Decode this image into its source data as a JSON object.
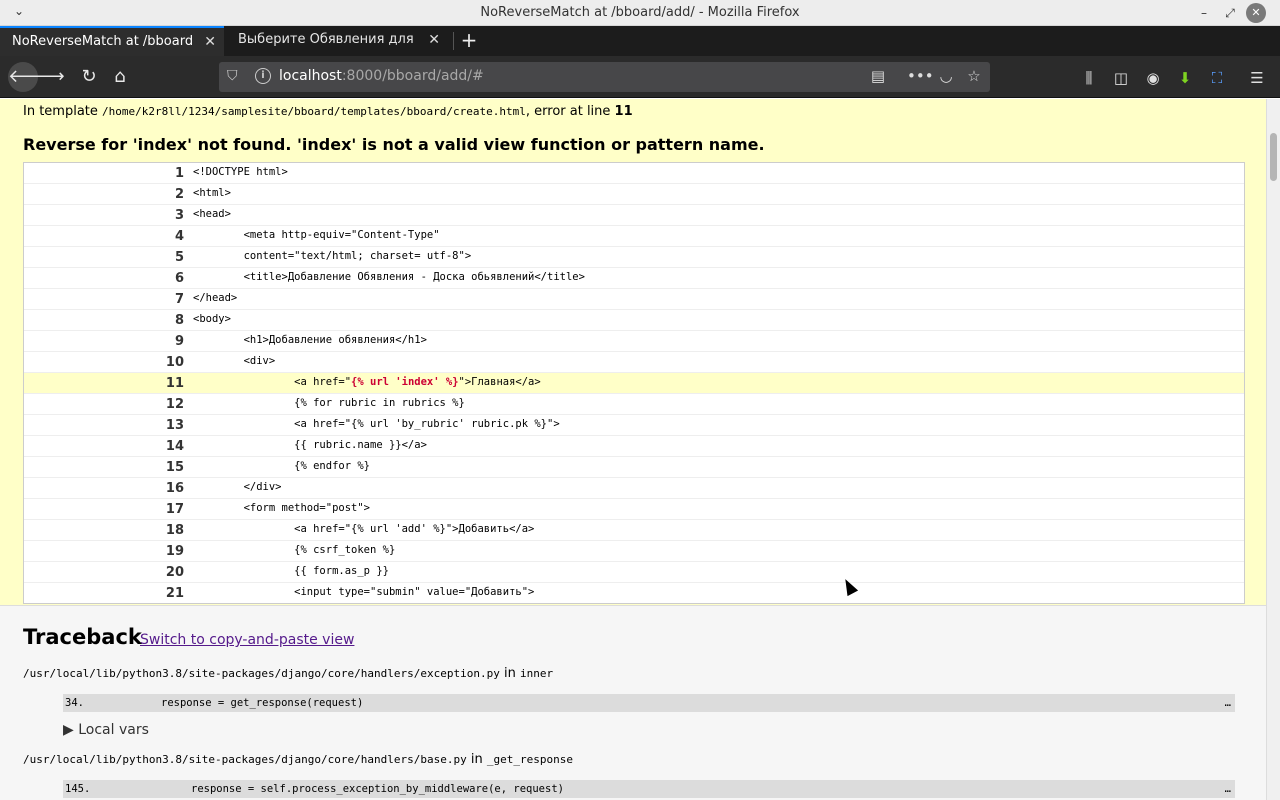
{
  "window": {
    "title": "NoReverseMatch at /bboard/add/ - Mozilla Firefox"
  },
  "tabs": [
    {
      "label": "NoReverseMatch at /bboard/"
    },
    {
      "label": "Выберите Обявления для из"
    }
  ],
  "navbar": {
    "url_host": "localhost",
    "url_rest": ":8000/bboard/add/#"
  },
  "error": {
    "template_prefix": "In template ",
    "template_path": "/home/k2r8ll/1234/samplesite/bboard/templates/bboard/create.html",
    "template_suffix": ", error at line ",
    "error_line": "11",
    "message": "Reverse for 'index' not found. 'index' is not a valid view function or pattern name."
  },
  "source_lines": [
    {
      "num": "1",
      "code": "<!DOCTYPE html>"
    },
    {
      "num": "2",
      "code": "<html>"
    },
    {
      "num": "3",
      "code": "<head>"
    },
    {
      "num": "4",
      "code": "        <meta http-equiv=\"Content-Type\""
    },
    {
      "num": "5",
      "code": "        content=\"text/html; charset= utf-8\">"
    },
    {
      "num": "6",
      "code": "        <title>Добавление Обявления - Доска обьявлений</title>"
    },
    {
      "num": "7",
      "code": "</head>"
    },
    {
      "num": "8",
      "code": "<body>"
    },
    {
      "num": "9",
      "code": "        <h1>Добавление обявления</h1>"
    },
    {
      "num": "10",
      "code": "        <div>"
    },
    {
      "num": "11",
      "code_before": "                <a href=\"",
      "code_tag": "{% url 'index' %}",
      "code_after": "\">Главная</a>"
    },
    {
      "num": "12",
      "code": "                {% for rubric in rubrics %}"
    },
    {
      "num": "13",
      "code": "                <a href=\"{% url 'by_rubric' rubric.pk %}\">"
    },
    {
      "num": "14",
      "code": "                {{ rubric.name }}</a>"
    },
    {
      "num": "15",
      "code": "                {% endfor %}"
    },
    {
      "num": "16",
      "code": "        </div>"
    },
    {
      "num": "17",
      "code": "        <form method=\"post\">"
    },
    {
      "num": "18",
      "code": "                <a href=\"{% url 'add' %}\">Добавить</a>"
    },
    {
      "num": "19",
      "code": "                {% csrf_token %}"
    },
    {
      "num": "20",
      "code": "                {{ form.as_p }}"
    },
    {
      "num": "21",
      "code": "                <input type=\"submin\" value=\"Добавить\">"
    }
  ],
  "traceback": {
    "heading": "Traceback",
    "switch_link": "Switch to copy-and-paste view",
    "in_word": " in ",
    "frames": [
      {
        "file": "/usr/local/lib/python3.8/site-packages/django/core/handlers/exception.py",
        "func": "inner",
        "line": "34.",
        "code": "response = get_response(request)",
        "more": "…",
        "local_vars": "▶ Local vars"
      },
      {
        "file": "/usr/local/lib/python3.8/site-packages/django/core/handlers/base.py",
        "func": "_get_response",
        "line": "145.",
        "code": "response = self.process_exception_by_middleware(e, request)",
        "more": "…"
      }
    ]
  }
}
